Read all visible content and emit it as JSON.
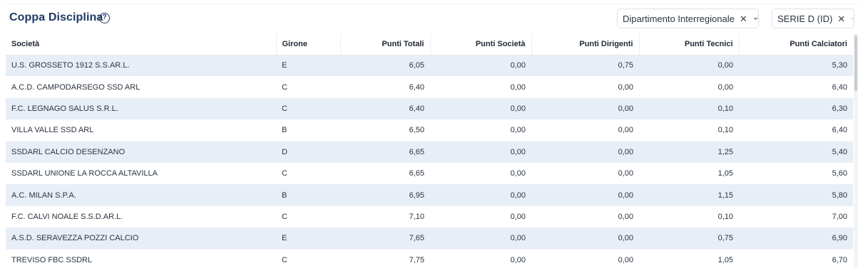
{
  "header": {
    "title": "Coppa Disciplina",
    "help_icon": "help-circle-icon"
  },
  "filters": {
    "dipartimento": {
      "label": "Dipartimento Interregionale",
      "clear_icon": "close-icon",
      "expand_icon": "chevron-down-icon"
    },
    "serie": {
      "label": "SERIE D (ID)",
      "clear_icon": "close-icon",
      "expand_icon": "chevron-down-icon"
    }
  },
  "table": {
    "columns": [
      "Società",
      "Girone",
      "Punti Totali",
      "Punti Società",
      "Punti Dirigenti",
      "Punti Tecnici",
      "Punti Calciatori"
    ],
    "rows": [
      [
        "U.S. GROSSETO 1912 S.S.AR.L.",
        "E",
        "6,05",
        "0,00",
        "0,75",
        "0,00",
        "5,30"
      ],
      [
        "A.C.D. CAMPODARSEGO SSD ARL",
        "C",
        "6,40",
        "0,00",
        "0,00",
        "0,00",
        "6,40"
      ],
      [
        "F.C. LEGNAGO SALUS S.R.L.",
        "C",
        "6,40",
        "0,00",
        "0,00",
        "0,10",
        "6,30"
      ],
      [
        " VILLA VALLE SSD ARL",
        "B",
        "6,50",
        "0,00",
        "0,00",
        "0,10",
        "6,40"
      ],
      [
        "SSDARL CALCIO DESENZANO",
        "D",
        "6,65",
        "0,00",
        "0,00",
        "1,25",
        "5,40"
      ],
      [
        "SSDARL UNIONE LA ROCCA ALTAVILLA",
        "C",
        "6,65",
        "0,00",
        "0,00",
        "1,05",
        "5,60"
      ],
      [
        "A.C. MILAN S.P.A.",
        "B",
        "6,95",
        "0,00",
        "0,00",
        "1,15",
        "5,80"
      ],
      [
        "F.C. CALVI NOALE S.S.D.AR.L.",
        "C",
        "7,10",
        "0,00",
        "0,00",
        "0,10",
        "7,00"
      ],
      [
        "A.S.D. SERAVEZZA POZZI CALCIO",
        "E",
        "7,65",
        "0,00",
        "0,00",
        "0,75",
        "6,90"
      ],
      [
        " TREVISO FBC SSDRL",
        "C",
        "7,75",
        "0,00",
        "0,00",
        "1,05",
        "6,70"
      ]
    ]
  },
  "colors": {
    "title": "#1f3a63",
    "row_alt": "#e8eef8",
    "border": "#dde1e6"
  }
}
